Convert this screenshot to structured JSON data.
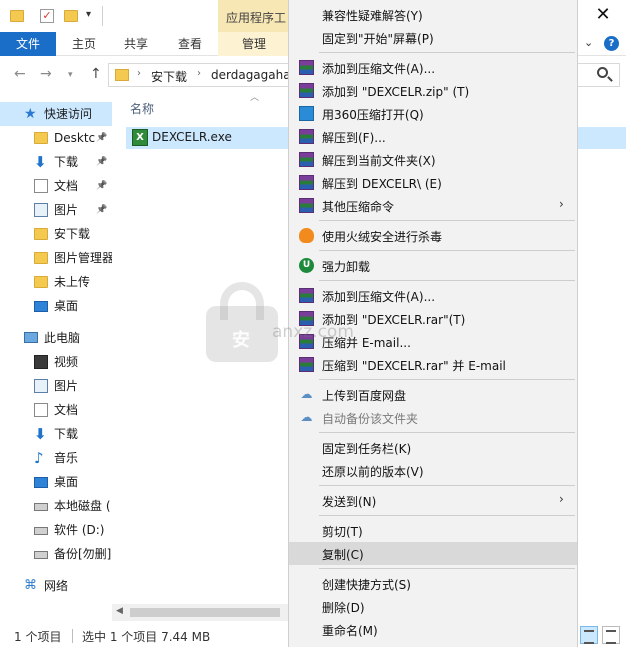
{
  "window": {
    "contextual_tab_top": "应用程序工",
    "close_glyph": "✕"
  },
  "ribbon": {
    "tabs": [
      "文件",
      "主页",
      "共享",
      "查看",
      "管理"
    ],
    "help": "?"
  },
  "address": {
    "segments": [
      "安下载",
      "derdagagaha"
    ]
  },
  "sidebar": {
    "items": [
      {
        "label": "快速访问",
        "icon": "star-icon",
        "pinned": false,
        "active": true
      },
      {
        "label": "Desktc",
        "icon": "folder-icon",
        "pinned": true
      },
      {
        "label": "下载",
        "icon": "download-arrow-icon",
        "pinned": true
      },
      {
        "label": "文档",
        "icon": "document-icon",
        "pinned": true
      },
      {
        "label": "图片",
        "icon": "picture-icon",
        "pinned": true
      },
      {
        "label": "安下载",
        "icon": "folder-icon",
        "pinned": false
      },
      {
        "label": "图片管理器",
        "icon": "folder-icon",
        "pinned": false
      },
      {
        "label": "未上传",
        "icon": "folder-icon",
        "pinned": false
      },
      {
        "label": "桌面",
        "icon": "desktop-icon",
        "pinned": false
      },
      {
        "label": "此电脑",
        "icon": "computer-icon",
        "pinned": false
      },
      {
        "label": "视频",
        "icon": "video-icon",
        "pinned": false
      },
      {
        "label": "图片",
        "icon": "picture-icon",
        "pinned": false
      },
      {
        "label": "文档",
        "icon": "document-icon",
        "pinned": false
      },
      {
        "label": "下载",
        "icon": "download-arrow-icon",
        "pinned": false
      },
      {
        "label": "音乐",
        "icon": "music-note-icon",
        "pinned": false
      },
      {
        "label": "桌面",
        "icon": "desktop-icon",
        "pinned": false
      },
      {
        "label": "本地磁盘 (",
        "icon": "drive-icon",
        "pinned": false
      },
      {
        "label": "软件 (D:)",
        "icon": "drive-icon",
        "pinned": false
      },
      {
        "label": "备份[勿删]",
        "icon": "drive-icon",
        "pinned": false
      },
      {
        "label": "网络",
        "icon": "network-icon",
        "pinned": false
      }
    ]
  },
  "files": {
    "column_name": "名称",
    "rows": [
      {
        "name": "DEXCELR.exe",
        "icon": "exe-icon"
      }
    ]
  },
  "status": {
    "item_count": "1 个项目",
    "selection": "选中 1 个项目  7.44 MB"
  },
  "context_menu": {
    "items": [
      {
        "label": "兼容性疑难解答(Y)",
        "icon": null
      },
      {
        "label": "固定到\"开始\"屏幕(P)",
        "icon": null
      },
      {
        "sep": true
      },
      {
        "label": "添加到压缩文件(A)...",
        "icon": "winrar-icon"
      },
      {
        "label": "添加到 \"DEXCELR.zip\" (T)",
        "icon": "winrar-icon"
      },
      {
        "label": "用360压缩打开(Q)",
        "icon": "compress-360-icon"
      },
      {
        "label": "解压到(F)...",
        "icon": "winrar-icon"
      },
      {
        "label": "解压到当前文件夹(X)",
        "icon": "winrar-icon"
      },
      {
        "label": "解压到 DEXCELR\\ (E)",
        "icon": "winrar-icon"
      },
      {
        "label": "其他压缩命令",
        "icon": "winrar-icon",
        "submenu": true
      },
      {
        "sep": true
      },
      {
        "label": "使用火绒安全进行杀毒",
        "icon": "huorong-flame-icon"
      },
      {
        "sep": true
      },
      {
        "label": "强力卸载",
        "icon": "uninstall-icon"
      },
      {
        "sep": true
      },
      {
        "label": "添加到压缩文件(A)...",
        "icon": "winrar-icon"
      },
      {
        "label": "添加到 \"DEXCELR.rar\"(T)",
        "icon": "winrar-icon"
      },
      {
        "label": "压缩并 E-mail...",
        "icon": "winrar-icon"
      },
      {
        "label": "压缩到 \"DEXCELR.rar\" 并 E-mail",
        "icon": "winrar-icon"
      },
      {
        "sep": true
      },
      {
        "label": "上传到百度网盘",
        "icon": "baidu-cloud-icon"
      },
      {
        "label": "自动备份该文件夹",
        "icon": "baidu-cloud-icon",
        "dim": true
      },
      {
        "sep": true
      },
      {
        "label": "固定到任务栏(K)",
        "icon": null
      },
      {
        "label": "还原以前的版本(V)",
        "icon": null
      },
      {
        "sep": true
      },
      {
        "label": "发送到(N)",
        "icon": null,
        "submenu": true
      },
      {
        "sep": true
      },
      {
        "label": "剪切(T)",
        "icon": null
      },
      {
        "label": "复制(C)",
        "icon": null,
        "highlighted": true
      },
      {
        "sep": true
      },
      {
        "label": "创建快捷方式(S)",
        "icon": null
      },
      {
        "label": "删除(D)",
        "icon": null
      },
      {
        "label": "重命名(M)",
        "icon": null
      }
    ]
  },
  "watermark": {
    "lock_char": "安",
    "text": "anxz.com"
  },
  "colors": {
    "accent": "#1a6ec7",
    "selection": "#cce8ff",
    "menu_bg": "#f2f2f2",
    "menu_highlight": "#d9d9d9"
  }
}
